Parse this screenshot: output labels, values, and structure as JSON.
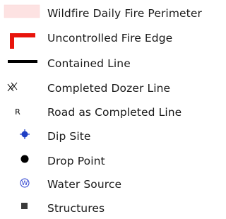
{
  "legend": {
    "items": [
      {
        "label": "Wildfire Daily Fire Perimeter",
        "icon": "fire-perimeter-swatch-icon",
        "color": "#fde2e2"
      },
      {
        "label": "Uncontrolled Fire Edge",
        "icon": "uncontrolled-fire-edge-icon",
        "color": "#e8140c"
      },
      {
        "label": "Contained Line",
        "icon": "contained-line-icon",
        "color": "#000000"
      },
      {
        "label": "Completed Dozer Line",
        "icon": "dozer-line-icon",
        "color": "#000000"
      },
      {
        "label": "Road as Completed Line",
        "icon": "road-line-icon",
        "symbol_text": "R",
        "color": "#000000"
      },
      {
        "label": "Dip Site",
        "icon": "dip-site-icon",
        "color": "#1f3fc4"
      },
      {
        "label": "Drop Point",
        "icon": "drop-point-icon",
        "color": "#000000"
      },
      {
        "label": "Water Source",
        "icon": "water-source-icon",
        "symbol_text": "W",
        "color": "#2a3fd0"
      },
      {
        "label": "Structures",
        "icon": "structure-icon",
        "color": "#3a3a3a"
      }
    ]
  }
}
